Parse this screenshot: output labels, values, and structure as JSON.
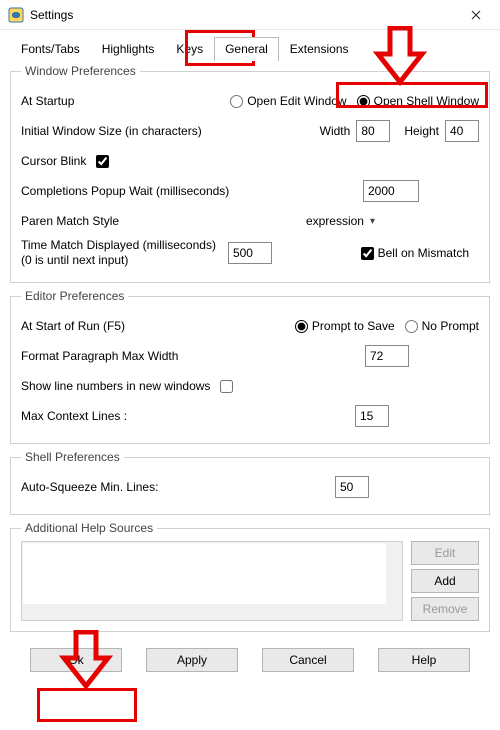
{
  "title": "Settings",
  "tabs": [
    {
      "label": "Fonts/Tabs",
      "active": false
    },
    {
      "label": "Highlights",
      "active": false
    },
    {
      "label": "Keys",
      "active": false
    },
    {
      "label": "General",
      "active": true
    },
    {
      "label": "Extensions",
      "active": false
    }
  ],
  "window_prefs": {
    "legend": "Window Preferences",
    "startup": {
      "label": "At Startup",
      "edit": "Open Edit Window",
      "shell": "Open Shell Window",
      "selected": "shell"
    },
    "size": {
      "label": "Initial Window Size  (in characters)",
      "width_label": "Width",
      "width": "80",
      "height_label": "Height",
      "height": "40"
    },
    "cursor_blink": {
      "label": "Cursor Blink",
      "checked": true
    },
    "completions": {
      "label": "Completions Popup Wait (milliseconds)",
      "value": "2000"
    },
    "paren": {
      "label": "Paren Match Style",
      "value": "expression"
    },
    "time_match": {
      "label1": "Time Match Displayed (milliseconds)",
      "label2": "(0 is until next input)",
      "value": "500",
      "bell_label": "Bell on Mismatch",
      "bell_checked": true
    }
  },
  "editor_prefs": {
    "legend": "Editor Preferences",
    "start_run": {
      "label": "At Start of Run (F5)",
      "prompt": "Prompt to Save",
      "noprompt": "No Prompt",
      "selected": "prompt"
    },
    "format_width": {
      "label": "Format Paragraph Max Width",
      "value": "72"
    },
    "linenums": {
      "label": "Show line numbers in new windows",
      "checked": false
    },
    "context": {
      "label": "Max Context Lines :",
      "value": "15"
    }
  },
  "shell_prefs": {
    "legend": "Shell Preferences",
    "autosqueeze": {
      "label": "Auto-Squeeze Min. Lines:",
      "value": "50"
    }
  },
  "help_sources": {
    "legend": "Additional Help Sources",
    "edit": "Edit",
    "add": "Add",
    "remove": "Remove"
  },
  "buttons": {
    "ok": "Ok",
    "apply": "Apply",
    "cancel": "Cancel",
    "help": "Help"
  }
}
